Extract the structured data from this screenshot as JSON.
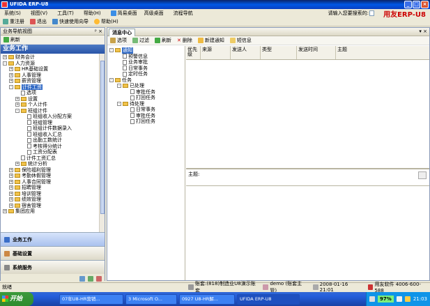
{
  "window": {
    "title": "UFIDA ERP-U8",
    "buttons": [
      "_",
      "□",
      "×"
    ]
  },
  "menubar": {
    "items": [
      "系统(S)",
      "视图(V)",
      "工具(T)",
      "帮助(H)",
      "简易桌面",
      "高级桌面",
      "流程导航"
    ],
    "search_label": "请输入您要搜索的:",
    "logo": "用友ERP-U8"
  },
  "toolbar": {
    "items": [
      "重注册",
      "退出",
      "快速使用向导",
      "帮助(H)"
    ]
  },
  "leftpanel": {
    "title": "业务导航视图",
    "refresh": "刷新",
    "section": "业务工作",
    "tree": [
      {
        "label": "财务会计",
        "level": 0,
        "type": "folder",
        "expander": "+"
      },
      {
        "label": "人力资源",
        "level": 0,
        "type": "folder",
        "expander": "-"
      },
      {
        "label": "HR基础设置",
        "level": 1,
        "type": "folder",
        "expander": "+"
      },
      {
        "label": "人事管理",
        "level": 1,
        "type": "folder",
        "expander": "+"
      },
      {
        "label": "薪资管理",
        "level": 1,
        "type": "folder",
        "expander": "+"
      },
      {
        "label": "计件工资",
        "level": 1,
        "type": "folder",
        "expander": "-",
        "selected": true
      },
      {
        "label": "选项",
        "level": 2,
        "type": "doc",
        "expander": ""
      },
      {
        "label": "设置",
        "level": 2,
        "type": "folder",
        "expander": "+"
      },
      {
        "label": "个人计件",
        "level": 2,
        "type": "folder",
        "expander": "+"
      },
      {
        "label": "班组计件",
        "level": 2,
        "type": "folder",
        "expander": "-"
      },
      {
        "label": "班组收入分配方案",
        "level": 3,
        "type": "doc",
        "expander": ""
      },
      {
        "label": "班组管理",
        "level": 3,
        "type": "doc",
        "expander": ""
      },
      {
        "label": "班组计件数据录入",
        "level": 3,
        "type": "doc",
        "expander": ""
      },
      {
        "label": "班组收入汇总",
        "level": 3,
        "type": "doc",
        "expander": ""
      },
      {
        "label": "出勤工数统计",
        "level": 3,
        "type": "doc",
        "expander": ""
      },
      {
        "label": "考核得分统计",
        "level": 3,
        "type": "doc",
        "expander": ""
      },
      {
        "label": "工资分配表",
        "level": 3,
        "type": "doc",
        "expander": ""
      },
      {
        "label": "计件工资汇总",
        "level": 2,
        "type": "doc",
        "expander": ""
      },
      {
        "label": "统计分析",
        "level": 2,
        "type": "folder",
        "expander": "+"
      },
      {
        "label": "保险福利管理",
        "level": 1,
        "type": "folder",
        "expander": "+"
      },
      {
        "label": "考勤休假管理",
        "level": 1,
        "type": "folder",
        "expander": "+"
      },
      {
        "label": "人事合同管理",
        "level": 1,
        "type": "folder",
        "expander": "+"
      },
      {
        "label": "招聘管理",
        "level": 1,
        "type": "folder",
        "expander": "+"
      },
      {
        "label": "培训管理",
        "level": 1,
        "type": "folder",
        "expander": "+"
      },
      {
        "label": "绩效管理",
        "level": 1,
        "type": "folder",
        "expander": "+"
      },
      {
        "label": "宿舍管理",
        "level": 1,
        "type": "folder",
        "expander": "+"
      },
      {
        "label": "集团应用",
        "level": 0,
        "type": "folder",
        "expander": "+"
      }
    ],
    "nav_buttons": [
      "业务工作",
      "基础设置",
      "系统服务"
    ]
  },
  "rightpanel": {
    "tab": "消息中心",
    "toolbar": [
      "选项",
      "过滤",
      "刷新",
      "删除",
      "新建通知",
      "短信息"
    ],
    "msgtree": [
      {
        "label": "通知",
        "level": 0,
        "type": "folder",
        "expander": "-",
        "selected": true
      },
      {
        "label": "预警信息",
        "level": 1,
        "type": "doc"
      },
      {
        "label": "业务审批",
        "level": 1,
        "type": "doc"
      },
      {
        "label": "日常事务",
        "level": 1,
        "type": "doc"
      },
      {
        "label": "定时任务",
        "level": 1,
        "type": "doc"
      },
      {
        "label": "任务",
        "level": 0,
        "type": "folder",
        "expander": "-"
      },
      {
        "label": "已处理",
        "level": 1,
        "type": "folder",
        "expander": "-"
      },
      {
        "label": "审批任务",
        "level": 2,
        "type": "doc"
      },
      {
        "label": "打回任务",
        "level": 2,
        "type": "doc"
      },
      {
        "label": "待处理",
        "level": 1,
        "type": "folder",
        "expander": "-"
      },
      {
        "label": "日常事务",
        "level": 2,
        "type": "doc"
      },
      {
        "label": "审批任务",
        "level": 2,
        "type": "doc"
      },
      {
        "label": "打回任务",
        "level": 2,
        "type": "doc"
      }
    ],
    "grid_columns": [
      "优先级",
      "来源",
      "发送人",
      "类型",
      "发送时间",
      "主题"
    ],
    "subject_label": "主题:"
  },
  "statusbar": {
    "ready": "就绪",
    "account": "账套:(818)制造业U8演示账套",
    "user": "demo (账套主管)",
    "datetime": "2008-01-16 21:01",
    "vendor": "用友软件 4006-600-588"
  },
  "taskbar": {
    "start": "开始",
    "tasks": [
      "07年U8-HR营销...",
      "3 Microsoft O...",
      "0927 U8-HR解...",
      "UFIDA ERP-U8"
    ],
    "battery": "97%",
    "clock": "21:03"
  },
  "colors": {
    "selection": "#316ac5",
    "titlebar": "#0058e6",
    "taskbar": "#245edb",
    "start": "#2e8b2e"
  }
}
